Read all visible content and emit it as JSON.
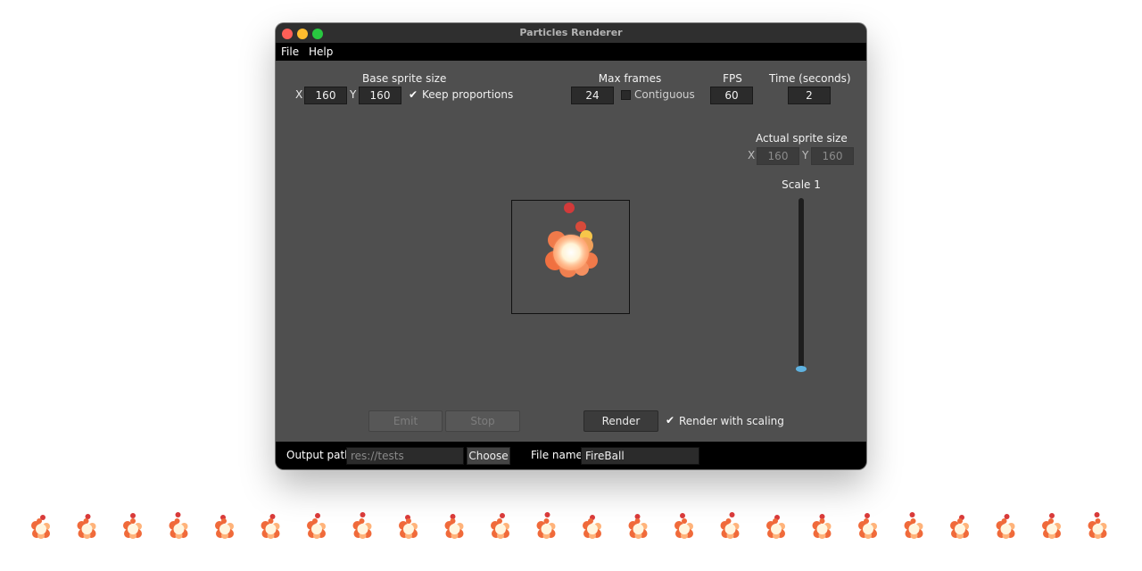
{
  "window": {
    "title": "Particles Renderer"
  },
  "menu": {
    "items": [
      "File",
      "Help"
    ]
  },
  "base_sprite": {
    "label": "Base sprite size",
    "x_label": "X",
    "x_value": "160",
    "y_label": "Y",
    "y_value": "160",
    "keep_proportions_label": "Keep proportions",
    "keep_proportions_checked": true
  },
  "max_frames": {
    "label": "Max frames",
    "value": "24",
    "contiguous_label": "Contiguous",
    "contiguous_checked": false
  },
  "fps": {
    "label": "FPS",
    "value": "60"
  },
  "time": {
    "label": "Time (seconds)",
    "value": "2"
  },
  "actual_sprite": {
    "label": "Actual sprite size",
    "x_label": "X",
    "x_value": "160",
    "y_label": "Y",
    "y_value": "160"
  },
  "scale": {
    "label": "Scale 1",
    "value": 1
  },
  "buttons": {
    "emit": "Emit",
    "stop": "Stop",
    "render": "Render"
  },
  "render_scaling": {
    "label": "Render with scaling",
    "checked": true
  },
  "footer": {
    "output_path_label": "Output path",
    "output_path_placeholder": "res://tests",
    "choose_label": "Choose",
    "file_name_label": "File name",
    "file_name_value": "FireBall"
  },
  "colors": {
    "fire_core": "#fff6e0",
    "fire_mid": "#ffb37a",
    "fire_outer": "#f06a3a",
    "ember": "#d83a3a",
    "accent": "#5fb2e0"
  },
  "frame_strip": {
    "count": 24
  }
}
